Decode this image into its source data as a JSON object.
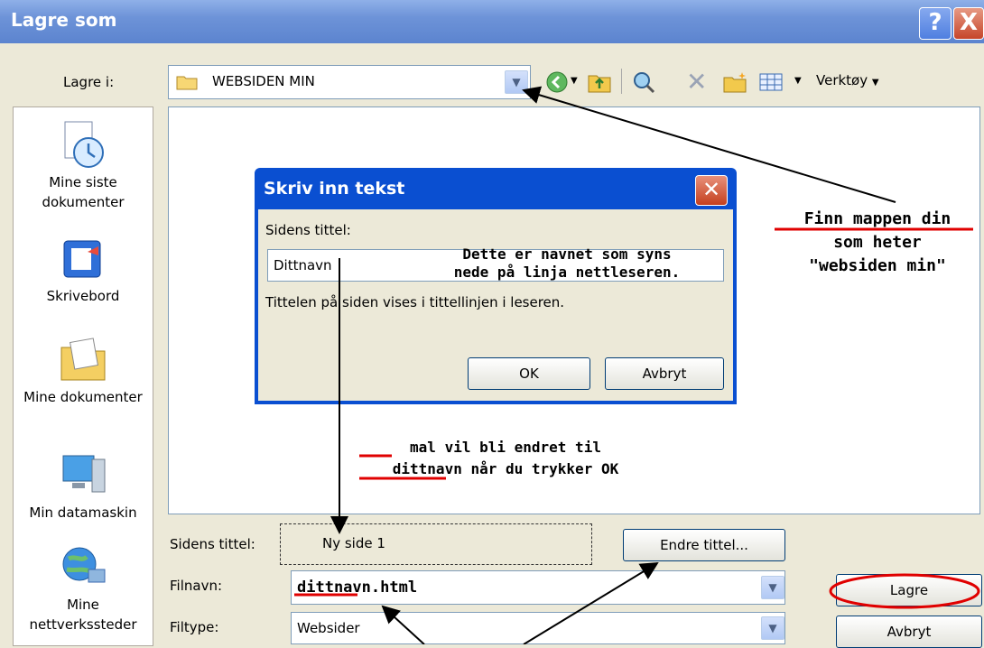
{
  "window": {
    "title": "Lagre som",
    "help_glyph": "?",
    "close_glyph": "X"
  },
  "toolbar": {
    "save_in_label": "Lagre i:",
    "save_in_value": "WEBSIDEN MIN",
    "tools_label": "Verktøy"
  },
  "places": [
    {
      "label": "Mine siste dokumenter",
      "icon": "recent-documents-icon"
    },
    {
      "label": "Skrivebord",
      "icon": "desktop-icon"
    },
    {
      "label": "Mine dokumenter",
      "icon": "my-documents-icon"
    },
    {
      "label": "Min datamaskin",
      "icon": "my-computer-icon"
    },
    {
      "label": "Mine nettverkssteder",
      "icon": "network-places-icon"
    }
  ],
  "dialog": {
    "title": "Skriv inn tekst",
    "field_label": "Sidens tittel:",
    "field_value": "Dittnavn",
    "hint": "Tittelen på siden vises i tittellinjen i leseren.",
    "ok_label": "OK",
    "cancel_label": "Avbryt"
  },
  "annotations": {
    "folder_note": [
      "Finn mappen din",
      "som heter",
      "\"websiden min\""
    ],
    "title_note": [
      "Dette er navnet som syns",
      "nede på linja nettleseren."
    ],
    "mal_note": [
      "mal vil bli endret til",
      "dittnavn når du trykker OK"
    ]
  },
  "form": {
    "page_title_label": "Sidens tittel:",
    "page_title_value": "Ny side 1",
    "change_title_label": "Endre tittel...",
    "filename_label": "Filnavn:",
    "filename_value": "dittnavn.html",
    "filetype_label": "Filtype:",
    "filetype_value": "Websider",
    "save_label": "Lagre",
    "cancel_label": "Avbryt"
  },
  "colors": {
    "titlebar": "#6d93d8",
    "dialog_title": "#0a4fd1",
    "annotation_red": "#e00000"
  }
}
